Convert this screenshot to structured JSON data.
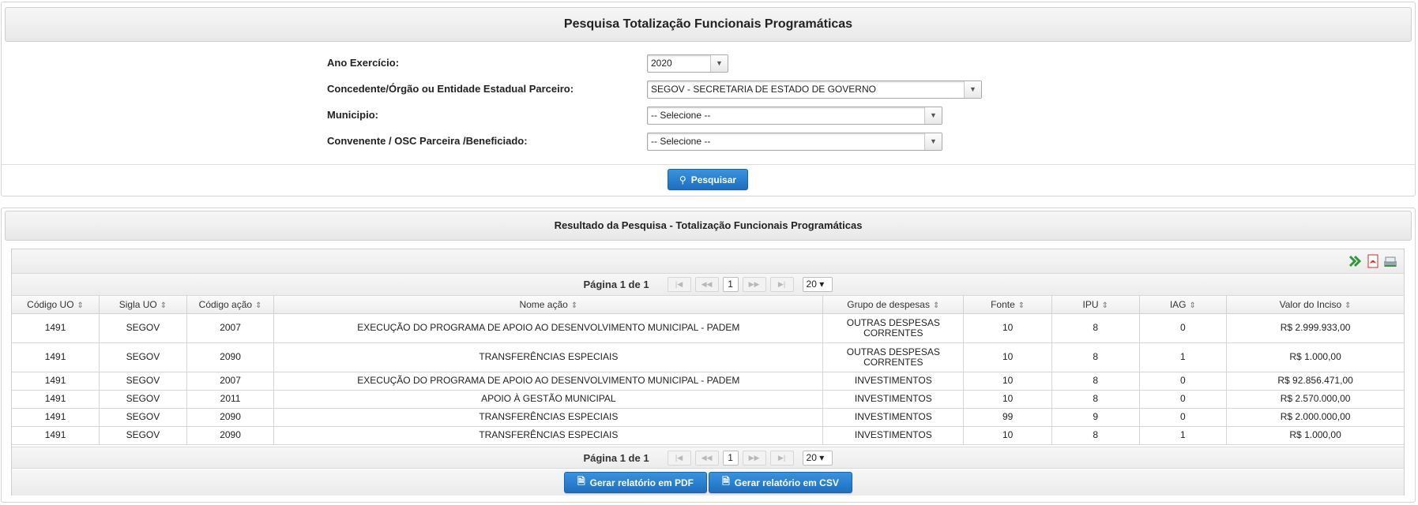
{
  "search": {
    "title": "Pesquisa Totalização Funcionais Programáticas",
    "fields": {
      "ano": {
        "label": "Ano Exercício:",
        "value": "2020"
      },
      "concedente": {
        "label": "Concedente/Órgão ou Entidade Estadual Parceiro:",
        "value": "SEGOV - SECRETARIA DE ESTADO DE GOVERNO"
      },
      "municipio": {
        "label": "Municipio:",
        "value": "-- Selecione --"
      },
      "convenente": {
        "label": "Convenente / OSC Parceira /Beneficiado:",
        "value": "-- Selecione --"
      }
    },
    "search_button": "Pesquisar"
  },
  "results": {
    "title": "Resultado da Pesquisa - Totalização Funcionais Programáticas",
    "page_text": "Página 1 de 1",
    "current_page": "1",
    "rows_per_page": "20",
    "columns": [
      "Código UO",
      "Sigla UO",
      "Código ação",
      "Nome ação",
      "Grupo de despesas",
      "Fonte",
      "IPU",
      "IAG",
      "Valor do Inciso"
    ],
    "rows": [
      [
        "1491",
        "SEGOV",
        "2007",
        "EXECUÇÃO DO PROGRAMA DE APOIO AO DESENVOLVIMENTO MUNICIPAL - PADEM",
        "OUTRAS DESPESAS CORRENTES",
        "10",
        "8",
        "0",
        "R$ 2.999.933,00"
      ],
      [
        "1491",
        "SEGOV",
        "2090",
        "TRANSFERÊNCIAS ESPECIAIS",
        "OUTRAS DESPESAS CORRENTES",
        "10",
        "8",
        "1",
        "R$ 1.000,00"
      ],
      [
        "1491",
        "SEGOV",
        "2007",
        "EXECUÇÃO DO PROGRAMA DE APOIO AO DESENVOLVIMENTO MUNICIPAL - PADEM",
        "INVESTIMENTOS",
        "10",
        "8",
        "0",
        "R$ 92.856.471,00"
      ],
      [
        "1491",
        "SEGOV",
        "2011",
        "APOIO À GESTÃO MUNICIPAL",
        "INVESTIMENTOS",
        "10",
        "8",
        "0",
        "R$ 2.570.000,00"
      ],
      [
        "1491",
        "SEGOV",
        "2090",
        "TRANSFERÊNCIAS ESPECIAIS",
        "INVESTIMENTOS",
        "99",
        "9",
        "0",
        "R$ 2.000.000,00"
      ],
      [
        "1491",
        "SEGOV",
        "2090",
        "TRANSFERÊNCIAS ESPECIAIS",
        "INVESTIMENTOS",
        "10",
        "8",
        "1",
        "R$ 1.000,00"
      ]
    ],
    "export_pdf_button": "Gerar relatório em PDF",
    "export_csv_button": "Gerar relatório em CSV",
    "export_icons": [
      "excel-icon",
      "pdf-icon",
      "csv-icon"
    ]
  },
  "colors": {
    "primary_button": "#1c6fc2",
    "header_gradient_top": "#f6f6f6",
    "header_gradient_bottom": "#e8e8e8"
  }
}
